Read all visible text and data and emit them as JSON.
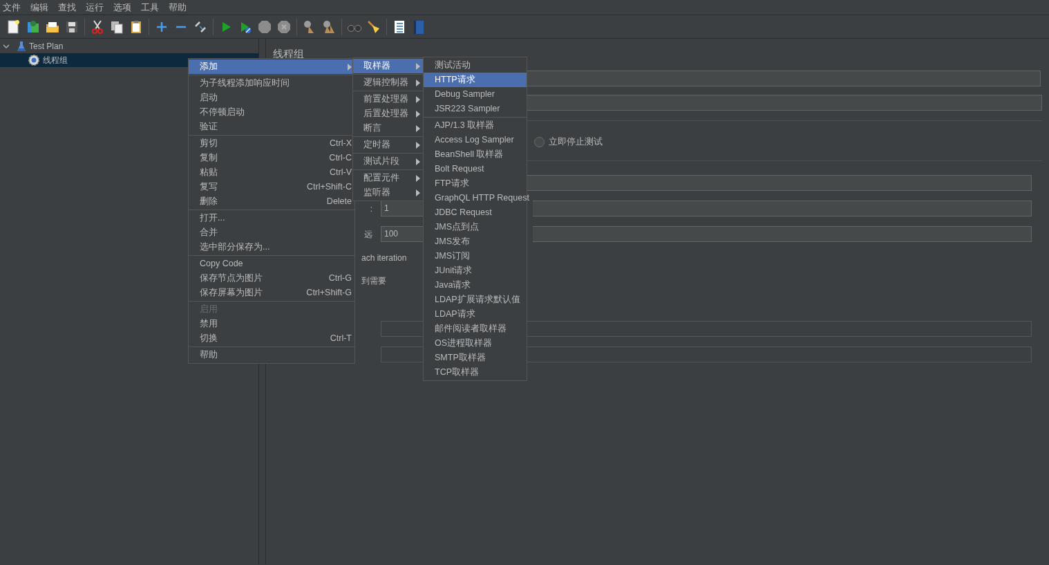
{
  "menubar": [
    "文件",
    "编辑",
    "查找",
    "运行",
    "选项",
    "工具",
    "帮助"
  ],
  "tree": [
    {
      "label": "Test Plan",
      "expanded": true,
      "selected": false,
      "children": [
        {
          "label": "线程组",
          "selected": true
        }
      ]
    }
  ],
  "panel": {
    "title": "线程组",
    "radio_label": "立即停止测试",
    "radio_selected": false,
    "rows": [
      {
        "kind": "field",
        "value": ""
      },
      {
        "kind": "field",
        "value": ""
      },
      {
        "kind": "divider"
      },
      {
        "kind": "radio"
      },
      {
        "kind": "divider"
      },
      {
        "kind": "field",
        "value": ""
      },
      {
        "kind": "labeled_field",
        "label": ":",
        "value": "1"
      },
      {
        "kind": "labeled_field",
        "label": "远",
        "value": "100"
      },
      {
        "kind": "text",
        "text": "ach iteration"
      },
      {
        "kind": "text",
        "text": "到需要"
      },
      {
        "kind": "disabled_field"
      },
      {
        "kind": "disabled_field"
      }
    ]
  },
  "context_menu": {
    "groups": [
      [
        {
          "label": "添加",
          "submenu": true,
          "selected": true,
          "disabled": false
        }
      ],
      [
        {
          "label": "为子线程添加响应时间",
          "selected": false,
          "disabled": false
        },
        {
          "label": "启动",
          "selected": false,
          "disabled": false
        },
        {
          "label": "不停顿启动",
          "selected": false,
          "disabled": false
        },
        {
          "label": "验证",
          "selected": false,
          "disabled": false
        }
      ],
      [
        {
          "label": "剪切",
          "shortcut": "Ctrl-X",
          "selected": false,
          "disabled": false
        },
        {
          "label": "复制",
          "shortcut": "Ctrl-C",
          "selected": false,
          "disabled": false
        },
        {
          "label": "粘贴",
          "shortcut": "Ctrl-V",
          "selected": false,
          "disabled": false
        },
        {
          "label": "复写",
          "shortcut": "Ctrl+Shift-C",
          "selected": false,
          "disabled": false
        },
        {
          "label": "删除",
          "shortcut": "Delete",
          "selected": false,
          "disabled": false
        }
      ],
      [
        {
          "label": "打开...",
          "selected": false,
          "disabled": false
        },
        {
          "label": "合并",
          "selected": false,
          "disabled": false
        },
        {
          "label": "选中部分保存为...",
          "selected": false,
          "disabled": false
        }
      ],
      [
        {
          "label": "Copy Code",
          "selected": false,
          "disabled": false
        },
        {
          "label": "保存节点为图片",
          "shortcut": "Ctrl-G",
          "selected": false,
          "disabled": false
        },
        {
          "label": "保存屏幕为图片",
          "shortcut": "Ctrl+Shift-G",
          "selected": false,
          "disabled": false
        }
      ],
      [
        {
          "label": "启用",
          "selected": false,
          "disabled": true
        },
        {
          "label": "禁用",
          "selected": false,
          "disabled": false
        },
        {
          "label": "切换",
          "shortcut": "Ctrl-T",
          "selected": false,
          "disabled": false
        }
      ],
      [
        {
          "label": "帮助",
          "selected": false,
          "disabled": false
        }
      ]
    ]
  },
  "add_submenu": {
    "groups": [
      [
        {
          "label": "取样器",
          "submenu": true,
          "selected": true
        }
      ],
      [
        {
          "label": "逻辑控制器",
          "submenu": true,
          "selected": false
        }
      ],
      [
        {
          "label": "前置处理器",
          "submenu": true,
          "selected": false
        },
        {
          "label": "后置处理器",
          "submenu": true,
          "selected": false
        },
        {
          "label": "断言",
          "submenu": true,
          "selected": false
        }
      ],
      [
        {
          "label": "定时器",
          "submenu": true,
          "selected": false
        }
      ],
      [
        {
          "label": "测试片段",
          "submenu": true,
          "selected": false
        }
      ],
      [
        {
          "label": "配置元件",
          "submenu": true,
          "selected": false
        },
        {
          "label": "监听器",
          "submenu": true,
          "selected": false
        }
      ]
    ]
  },
  "sampler_submenu": {
    "groups": [
      [
        {
          "label": "测试活动",
          "selected": false
        },
        {
          "label": "HTTP请求",
          "selected": true
        },
        {
          "label": "Debug Sampler",
          "selected": false
        },
        {
          "label": "JSR223 Sampler",
          "selected": false
        }
      ],
      [
        {
          "label": "AJP/1.3 取样器",
          "selected": false
        },
        {
          "label": "Access Log Sampler",
          "selected": false
        },
        {
          "label": "BeanShell 取样器",
          "selected": false
        },
        {
          "label": "Bolt Request",
          "selected": false
        },
        {
          "label": "FTP请求",
          "selected": false
        },
        {
          "label": "GraphQL HTTP Request",
          "selected": false
        },
        {
          "label": "JDBC Request",
          "selected": false
        },
        {
          "label": "JMS点到点",
          "selected": false
        },
        {
          "label": "JMS发布",
          "selected": false
        },
        {
          "label": "JMS订阅",
          "selected": false
        },
        {
          "label": "JUnit请求",
          "selected": false
        },
        {
          "label": "Java请求",
          "selected": false
        },
        {
          "label": "LDAP扩展请求默认值",
          "selected": false
        },
        {
          "label": "LDAP请求",
          "selected": false
        },
        {
          "label": "邮件阅读者取样器",
          "selected": false
        },
        {
          "label": "OS进程取样器",
          "selected": false
        },
        {
          "label": "SMTP取样器",
          "selected": false
        },
        {
          "label": "TCP取样器",
          "selected": false
        }
      ]
    ]
  }
}
